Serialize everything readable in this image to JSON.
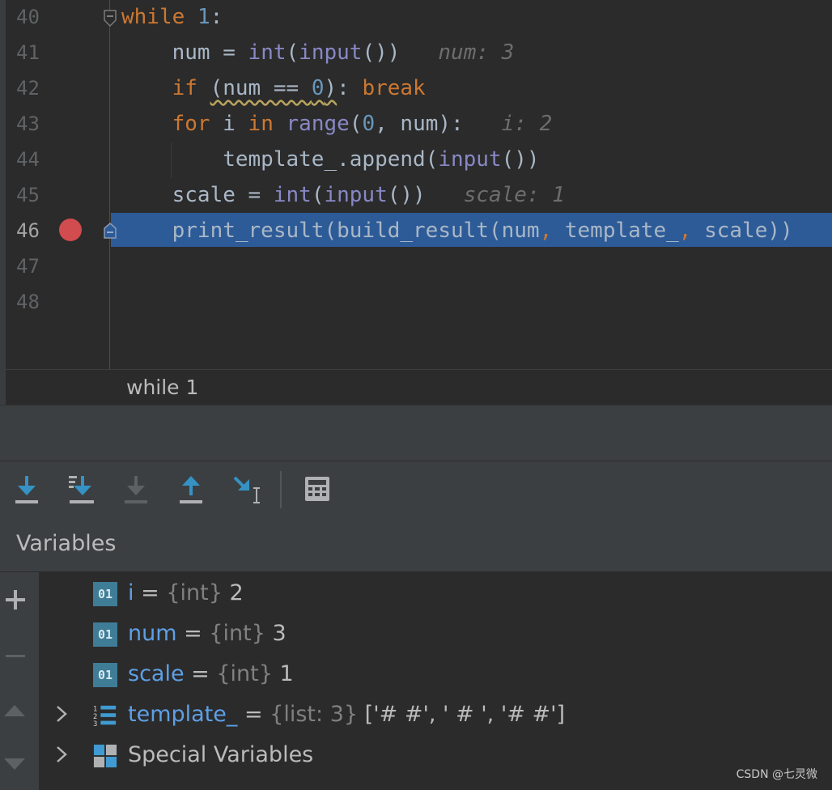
{
  "editor": {
    "lines": [
      {
        "number": "40"
      },
      {
        "number": "41",
        "hint": "num: 3"
      },
      {
        "number": "42"
      },
      {
        "number": "43",
        "hint": "i: 2"
      },
      {
        "number": "44"
      },
      {
        "number": "45",
        "hint": "scale: 1"
      },
      {
        "number": "46",
        "current": true,
        "breakpoint": true
      },
      {
        "number": "47"
      },
      {
        "number": "48"
      }
    ],
    "tokens": {
      "l40_while": "while",
      "l40_one": "1",
      "l40_colon": ":",
      "l41_a": "    num = ",
      "l41_int": "int",
      "l41_b": "(",
      "l41_input": "input",
      "l41_c": "())",
      "l42_if": "    if",
      "l42_a": " ",
      "l42_cond_a": "(num == ",
      "l42_zero": "0",
      "l42_cond_b": ")",
      "l42_b": ": ",
      "l42_break": "break",
      "l43_for": "    for",
      "l43_a": " i ",
      "l43_in": "in",
      "l43_b": " ",
      "l43_range": "range",
      "l43_c": "(",
      "l43_zero": "0",
      "l43_d": ", num):",
      "l44_a": "        template_.append(",
      "l44_input": "input",
      "l44_b": "())",
      "l45_a": "    scale = ",
      "l45_int": "int",
      "l45_b": "(",
      "l45_input": "input",
      "l45_c": "())",
      "l46_a": "    print_result(build_result(num",
      "l46_comma1": ",",
      "l46_b": " template_",
      "l46_comma2": ",",
      "l46_c": " scale))"
    }
  },
  "breadcrumb": {
    "text": "while 1"
  },
  "toolbar": {
    "buttons": [
      {
        "name": "step-over",
        "enabled": true
      },
      {
        "name": "step-into",
        "enabled": true
      },
      {
        "name": "step-into-my-code",
        "enabled": false
      },
      {
        "name": "step-out",
        "enabled": true
      },
      {
        "name": "run-to-cursor",
        "enabled": true
      },
      {
        "name": "evaluate-expression",
        "enabled": true
      }
    ]
  },
  "variables_panel": {
    "title": "Variables",
    "items": [
      {
        "name": "i",
        "type": "{int}",
        "value": "2",
        "icon": "primitive-icon",
        "expandable": false
      },
      {
        "name": "num",
        "type": "{int}",
        "value": "3",
        "icon": "primitive-icon",
        "expandable": false
      },
      {
        "name": "scale",
        "type": "{int}",
        "value": "1",
        "icon": "primitive-icon",
        "expandable": false
      },
      {
        "name": "template_",
        "type": "{list: 3}",
        "value": "['# #', ' # ', '# #']",
        "icon": "list-icon",
        "expandable": true
      },
      {
        "name": "Special Variables",
        "icon": "special-vars-icon",
        "expandable": true
      }
    ],
    "icon_label": "01",
    "equals": " = "
  },
  "watermark": "CSDN @七灵微",
  "colors": {
    "keyword": "#cc7832",
    "builtin": "#8888c6",
    "number": "#6897bb",
    "current_line": "#2d5b98",
    "breakpoint": "#d14c4f",
    "var_name": "#5e9fe6"
  }
}
